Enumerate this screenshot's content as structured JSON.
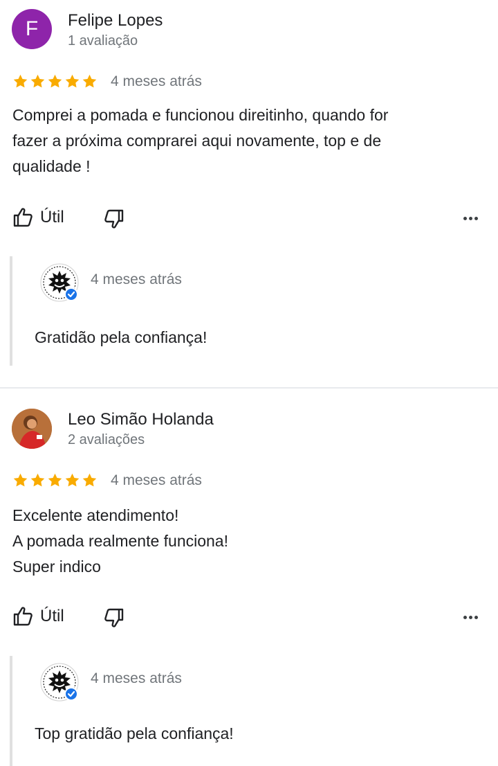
{
  "reviews": [
    {
      "avatar_letter": "F",
      "avatar_color": "#8e24aa",
      "name": "Felipe Lopes",
      "review_count": "1 avaliação",
      "rating": 5,
      "time": "4 meses atrás",
      "text": "Comprei a pomada e funcionou direitinho, quando for\nfazer a próxima comprarei aqui novamente, top e de\nqualidade !",
      "useful_label": "Útil",
      "reply": {
        "time": "4 meses atrás",
        "text": "Gratidão pela confiança!"
      }
    },
    {
      "avatar_letter": "",
      "name": "Leo Simão Holanda",
      "review_count": "2 avaliações",
      "rating": 5,
      "time": "4 meses atrás",
      "text": "Excelente atendimento!\nA pomada realmente funciona!\nSuper indico",
      "useful_label": "Útil",
      "reply": {
        "time": "4 meses atrás",
        "text": "Top gratidão pela confiança!"
      }
    }
  ],
  "colors": {
    "star": "#f9ab00",
    "verified": "#1a73e8",
    "secondary_text": "#70757a"
  },
  "icons": [
    "thumb-up-icon",
    "thumb-down-icon",
    "more-options-icon",
    "star-icon",
    "verified-badge-icon"
  ]
}
